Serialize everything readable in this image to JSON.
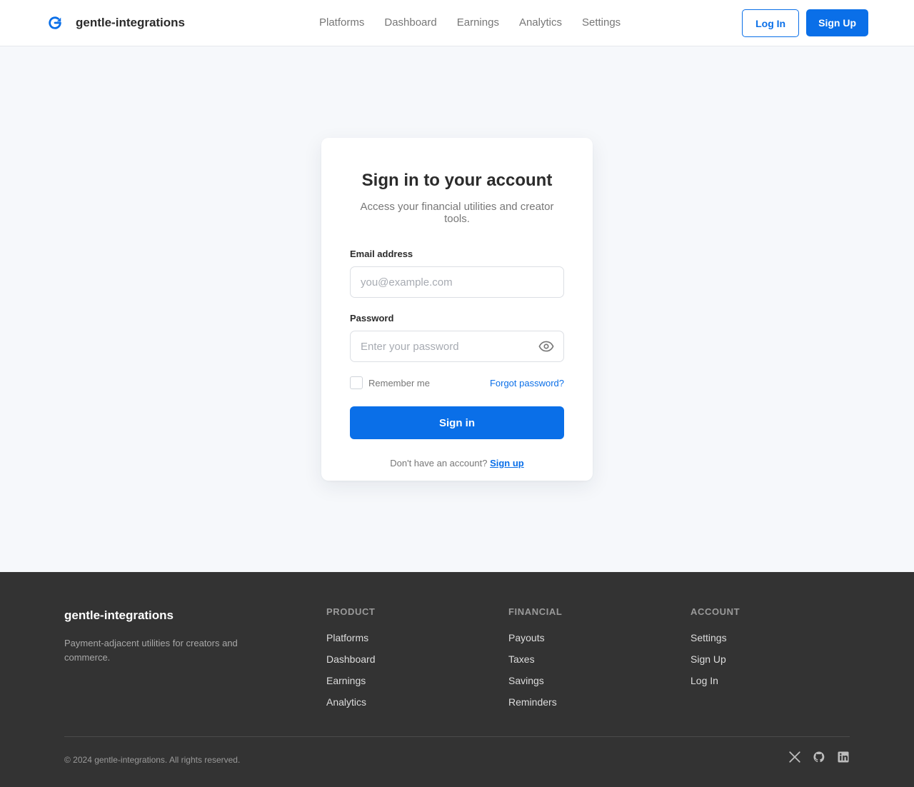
{
  "header": {
    "brand_name": "gentle-integrations",
    "brand_icon": "refresh-icon",
    "nav": [
      "Platforms",
      "Dashboard",
      "Earnings",
      "Analytics",
      "Settings"
    ],
    "login_label": "Log In",
    "signup_label": "Sign Up"
  },
  "card": {
    "title": "Sign in to your account",
    "subtitle": "Access your financial utilities and creator tools.",
    "email_label": "Email address",
    "email_placeholder": "you@example.com",
    "email_value": "",
    "password_label": "Password",
    "password_placeholder": "Enter your password",
    "password_value": "",
    "remember_label": "Remember me",
    "remember_checked": false,
    "forgot_label": "Forgot password?",
    "signin_label": "Sign in",
    "no_account_text": "Don't have an account?",
    "signup_link": "Sign up"
  },
  "footer": {
    "brand_name": "gentle-integrations",
    "tagline": "Payment-adjacent utilities for creators and commerce.",
    "columns": [
      {
        "heading": "PRODUCT",
        "links": [
          "Platforms",
          "Dashboard",
          "Earnings",
          "Analytics"
        ]
      },
      {
        "heading": "FINANCIAL",
        "links": [
          "Payouts",
          "Taxes",
          "Savings",
          "Reminders"
        ]
      },
      {
        "heading": "ACCOUNT",
        "links": [
          "Settings",
          "Sign Up",
          "Log In"
        ]
      }
    ],
    "copyright": "© 2024 gentle-integrations. All rights reserved.",
    "social_icons": [
      "x-icon",
      "github-icon",
      "linkedin-icon"
    ]
  },
  "colors": {
    "accent": "#0a6fe8",
    "page_bg": "#f6f8fb",
    "footer_bg": "#333333"
  }
}
